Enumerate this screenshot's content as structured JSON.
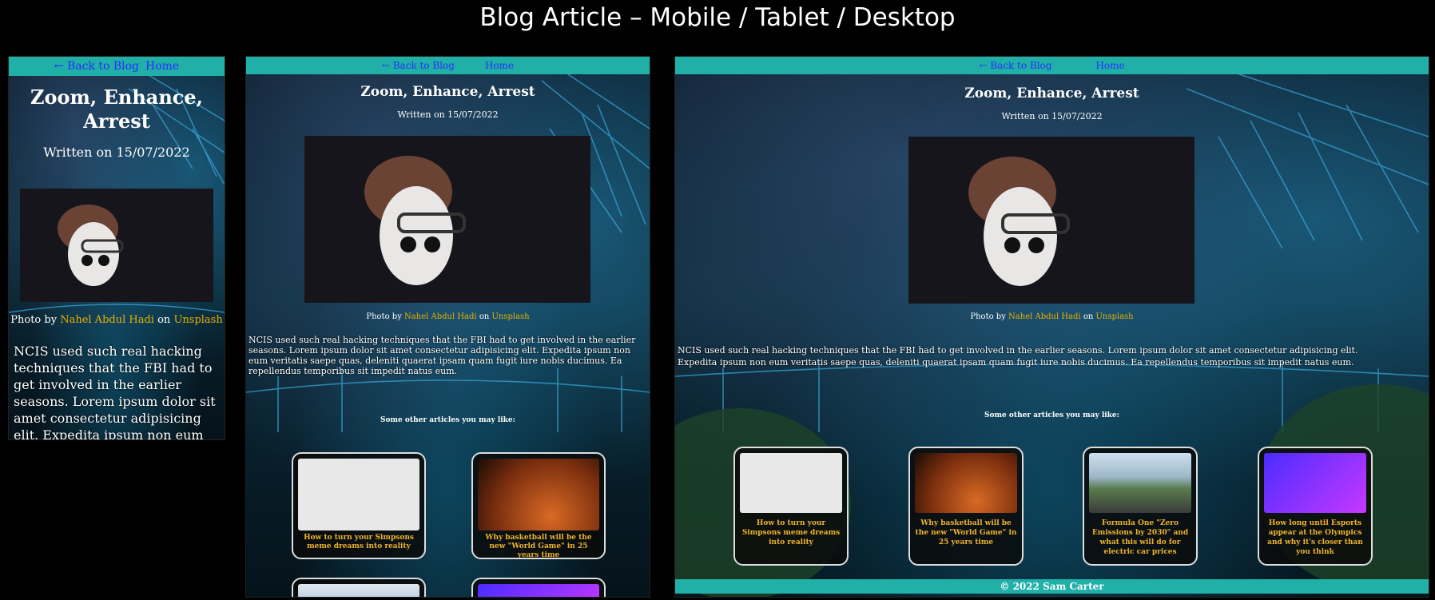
{
  "page_title": "Blog Article – Mobile / Tablet / Desktop",
  "nav": {
    "back": "← Back to Blog",
    "home": "Home"
  },
  "article": {
    "title": "Zoom, Enhance, Arrest",
    "written": "Written on 15/07/2022",
    "photo_by": "Photo by",
    "photographer": "Nahel Abdul Hadi",
    "on": "on",
    "source": "Unsplash",
    "body": "NCIS used such real hacking techniques that the FBI had to get involved in the earlier seasons. Lorem ipsum dolor sit amet consectetur adipisicing elit. Expedita ipsum non eum veritatis saepe quas, deleniti quaerat ipsam quam fugit iure nobis ducimus. Ea repellendus temporibus sit impedit natus eum.",
    "mobile_body": "NCIS used such real hacking techniques that the FBI had to get involved in the earlier seasons. Lorem ipsum dolor sit amet consectetur adipisicing elit. Expedita ipsum non eum"
  },
  "others_heading": "Some other articles you may like:",
  "cards": [
    {
      "caption": "How to turn your Simpsons meme dreams into reality",
      "color": "#e8e8e8"
    },
    {
      "caption": "Why basketball will be the new \"World Game\" in 25 years time",
      "color": "#c8561c"
    },
    {
      "caption": "Formula One \"Zero Emissions by 2030\" and what this will do for electric car prices",
      "color": "#6b8aa0"
    },
    {
      "caption": "How long until Esports appear at the Olympics and why it's closer than you think",
      "color": "#7a3fd6"
    }
  ],
  "footer": "© 2022 Sam Carter"
}
